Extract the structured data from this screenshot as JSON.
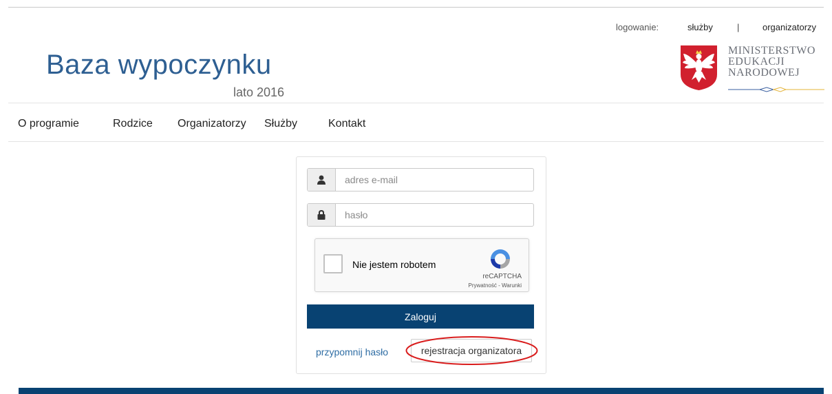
{
  "header": {
    "login_label": "logowanie:",
    "login_services": "służby",
    "separator": "|",
    "login_organizers": "organizatorzy",
    "site_title": "Baza wypoczynku",
    "site_subtitle": "lato 2016",
    "ministry_lines": [
      "MINISTERSTWO",
      "EDUKACJI",
      "NARODOWEJ"
    ]
  },
  "nav": {
    "items": [
      {
        "label": "O programie"
      },
      {
        "label": "Rodzice"
      },
      {
        "label": "Organizatorzy"
      },
      {
        "label": "Służby"
      },
      {
        "label": "Kontakt"
      }
    ]
  },
  "login_form": {
    "email": {
      "placeholder": "adres e-mail",
      "value": "",
      "icon": "user-icon"
    },
    "password": {
      "placeholder": "hasło",
      "value": "",
      "icon": "lock-icon"
    },
    "captcha": {
      "checkbox_label": "Nie jestem robotem",
      "checked": false,
      "brand": "reCAPTCHA",
      "terms": "Prywatność - Warunki"
    },
    "submit_label": "Zaloguj",
    "remind_password_label": "przypomnij hasło",
    "register_label": "rejestracja organizatora"
  },
  "colors": {
    "primary": "#084272",
    "title_blue": "#2e5f92",
    "link": "#2e6da4",
    "highlight_red": "#d91c1c",
    "emblem_red": "#d1202e"
  }
}
